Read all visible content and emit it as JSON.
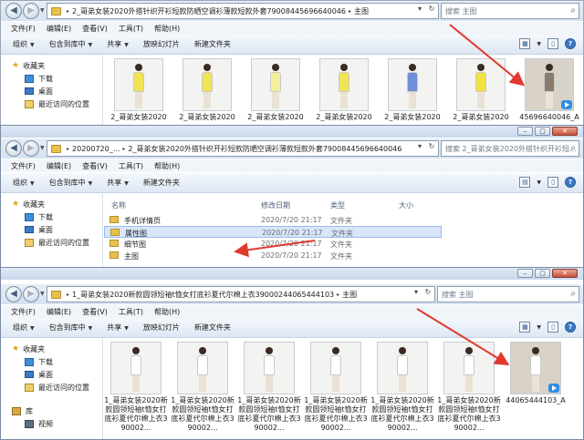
{
  "menu": [
    "文件(F)",
    "编辑(E)",
    "查看(V)",
    "工具(T)",
    "帮助(H)"
  ],
  "toolbar": {
    "organize": "组织",
    "include": "包含到库中",
    "share": "共享",
    "slideshow": "放映幻灯片",
    "newfolder": "新建文件夹"
  },
  "sidebar": {
    "favorites": "收藏夹",
    "downloads": "下载",
    "desktop": "桌面",
    "recent": "最近访问的位置",
    "libraries": "库",
    "videos": "视频"
  },
  "window1": {
    "path": [
      "2_哥弟女装2020外搭针织开衫短款防晒空调衫薄款短款外套79008445696640046",
      "主图"
    ],
    "search": "搜索 主图",
    "files": [
      {
        "name": "2_哥弟女装2020",
        "type": "image",
        "palette": "#f0e455"
      },
      {
        "name": "2_哥弟女装2020",
        "type": "image",
        "palette": "#f0e455"
      },
      {
        "name": "2_哥弟女装2020",
        "type": "image",
        "palette": "#f4ef9a"
      },
      {
        "name": "2_哥弟女装2020",
        "type": "image",
        "palette": "#f0e455"
      },
      {
        "name": "2_哥弟女装2020",
        "type": "image",
        "palette": "#6f8fd8"
      },
      {
        "name": "2_哥弟女装2020",
        "type": "image",
        "palette": "#f2e240"
      },
      {
        "name": "45696640046_A",
        "type": "video",
        "palette": "#8a7a6a"
      }
    ]
  },
  "window2": {
    "path": [
      "20200720_...",
      "2_哥弟女装2020外搭针织开衫短款防晒空调衫薄款短款外套79008445696640046"
    ],
    "search": "搜索 2_哥弟女装2020外搭针织开衫短...",
    "columns": {
      "name": "名称",
      "date": "修改日期",
      "type": "类型",
      "size": "大小"
    },
    "rows": [
      {
        "name": "手机详情页",
        "date": "2020/7/20 21:17",
        "type": "文件夹"
      },
      {
        "name": "属性图",
        "date": "2020/7/20 21:17",
        "type": "文件夹"
      },
      {
        "name": "细节图",
        "date": "2020/7/20 21:17",
        "type": "文件夹"
      },
      {
        "name": "主图",
        "date": "2020/7/20 21:17",
        "type": "文件夹"
      }
    ]
  },
  "window3": {
    "path": [
      "1_哥弟女装2020新款圆领短袖t恤女打底衫夏代尔棉上衣39000244065444103",
      "主图"
    ],
    "search": "搜索 主图",
    "files": [
      {
        "name": "1_哥弟女装2020新款圆领短袖t恤女打底衫夏代尔棉上衣390002...",
        "type": "image",
        "palette": "#ffffff"
      },
      {
        "name": "1_哥弟女装2020新款圆领短袖t恤女打底衫夏代尔棉上衣390002...",
        "type": "image",
        "palette": "#ffffff"
      },
      {
        "name": "1_哥弟女装2020新款圆领短袖t恤女打底衫夏代尔棉上衣390002...",
        "type": "image",
        "palette": "#ffffff"
      },
      {
        "name": "1_哥弟女装2020新款圆领短袖t恤女打底衫夏代尔棉上衣390002...",
        "type": "image",
        "palette": "#ffffff"
      },
      {
        "name": "1_哥弟女装2020新款圆领短袖t恤女打底衫夏代尔棉上衣390002...",
        "type": "image",
        "palette": "#ffffff"
      },
      {
        "name": "1_哥弟女装2020新款圆领短袖t恤女打底衫夏代尔棉上衣390002...",
        "type": "image",
        "palette": "#ffffff"
      },
      {
        "name": "44065444103_A",
        "type": "video",
        "palette": "#ffffff"
      }
    ]
  },
  "colors": {
    "arrow": "#e03a2f"
  }
}
